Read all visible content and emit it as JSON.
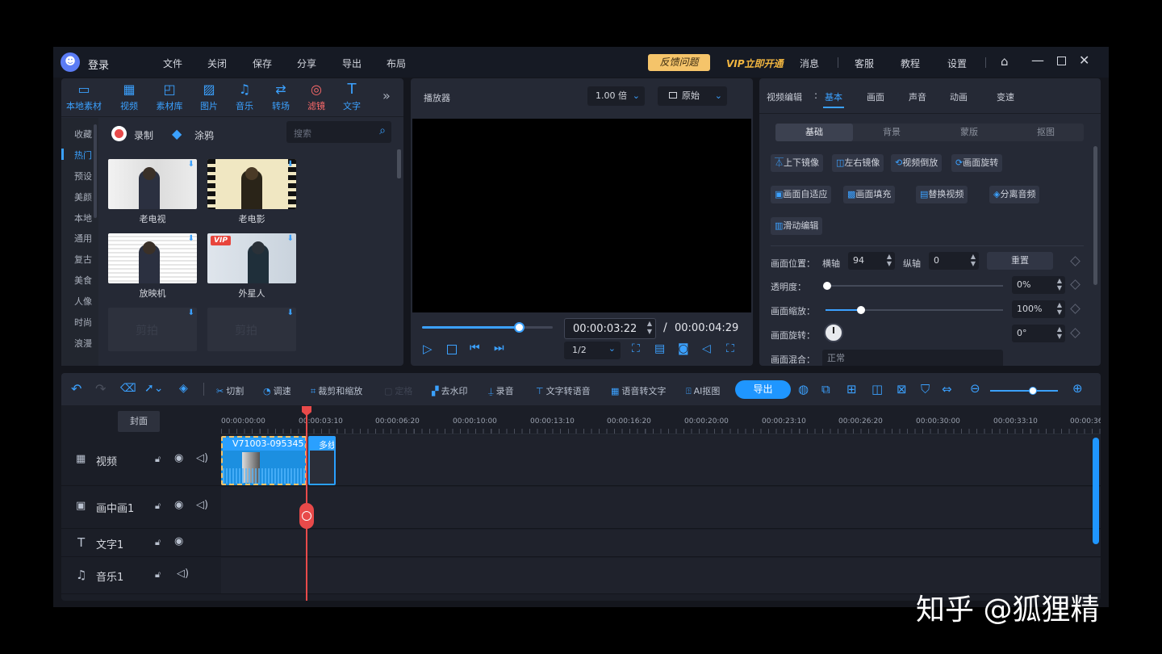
{
  "titlebar": {
    "login_label": "登录",
    "menus": [
      "文件",
      "关闭",
      "保存",
      "分享",
      "导出",
      "布局"
    ],
    "feedback_label": "反馈问题",
    "vip_label": "VIP立即开通",
    "right_menus": [
      "消息",
      "客服",
      "教程",
      "设置"
    ]
  },
  "media": {
    "tools": [
      {
        "label": "本地素材",
        "icon": "folder-icon"
      },
      {
        "label": "视频",
        "icon": "film-icon"
      },
      {
        "label": "素材库",
        "icon": "library-icon"
      },
      {
        "label": "图片",
        "icon": "image-icon"
      },
      {
        "label": "音乐",
        "icon": "music-icon"
      },
      {
        "label": "转场",
        "icon": "transition-icon"
      },
      {
        "label": "滤镜",
        "icon": "filter-icon"
      },
      {
        "label": "文字",
        "icon": "text-icon"
      }
    ],
    "categories": [
      "收藏",
      "热门",
      "预设",
      "美颜",
      "本地",
      "通用",
      "复古",
      "美食",
      "人像",
      "时尚",
      "浪漫"
    ],
    "record_label": "录制",
    "doodle_label": "涂鸦",
    "search_placeholder": "搜索",
    "filters": [
      {
        "label": "老电视"
      },
      {
        "label": "老电影"
      },
      {
        "label": "放映机"
      },
      {
        "label": "外星人",
        "badge": "VIP"
      },
      {
        "label": "",
        "placeholder": "剪拍"
      },
      {
        "label": "",
        "placeholder": "剪拍"
      }
    ]
  },
  "player": {
    "title": "播放器",
    "speed": "1.00 倍",
    "ratio": "原始",
    "current_time": "00:00:03:22",
    "separator": "/",
    "total_time": "00:00:04:29",
    "quality": "1/2",
    "progress": 0.74
  },
  "editor": {
    "section_label": "视频编辑",
    "tabs": [
      "基本",
      "画面",
      "声音",
      "动画",
      "变速"
    ],
    "subtabs": [
      "基础",
      "背景",
      "蒙版",
      "抠图"
    ],
    "buttons_row1": [
      "上下镜像",
      "左右镜像",
      "视频倒放",
      "画面旋转"
    ],
    "buttons_row2": [
      "画面自适应",
      "画面填充",
      "替换视频",
      "分离音频"
    ],
    "buttons_row3": [
      "滑动编辑"
    ],
    "position_label": "画面位置：",
    "x_label": "横轴",
    "x_value": "94",
    "y_label": "纵轴",
    "y_value": "0",
    "reset_label": "重置",
    "opacity_label": "透明度：",
    "opacity_value": "0%",
    "opacity_level": 0.0,
    "scale_label": "画面缩放：",
    "scale_value": "100%",
    "scale_level": 0.2,
    "rotate_label": "画面旋转：",
    "rotate_value": "0°",
    "blend_label": "画面混合：",
    "blend_value": "正常"
  },
  "timeline": {
    "tools": [
      "切割",
      "调速",
      "裁剪和缩放",
      "定格",
      "去水印",
      "录音",
      "文字转语音",
      "语音转文字",
      "AI抠图"
    ],
    "export_label": "导出",
    "cover_label": "封面",
    "ruler": [
      "00:00:00:00",
      "00:00:03:10",
      "00:00:06:20",
      "00:00:10:00",
      "00:00:13:10",
      "00:00:16:20",
      "00:00:20:00",
      "00:00:23:10",
      "00:00:26:20",
      "00:00:30:00",
      "00:00:33:10",
      "00:00:36"
    ],
    "tracks": [
      {
        "label": "视频",
        "icon": "video-track-icon"
      },
      {
        "label": "画中画1",
        "icon": "pip-track-icon"
      },
      {
        "label": "文字1",
        "icon": "text-track-icon"
      },
      {
        "label": "音乐1",
        "icon": "music-track-icon"
      }
    ],
    "clip1_label": "V71003-095345.r",
    "clip2_label": "多线"
  },
  "watermark": "知乎 @狐狸精",
  "colors": {
    "accent": "#3ba1ff",
    "playhead": "#e84a4a",
    "feedback_bg": "#f5c46a",
    "vip": "#f2b640"
  }
}
